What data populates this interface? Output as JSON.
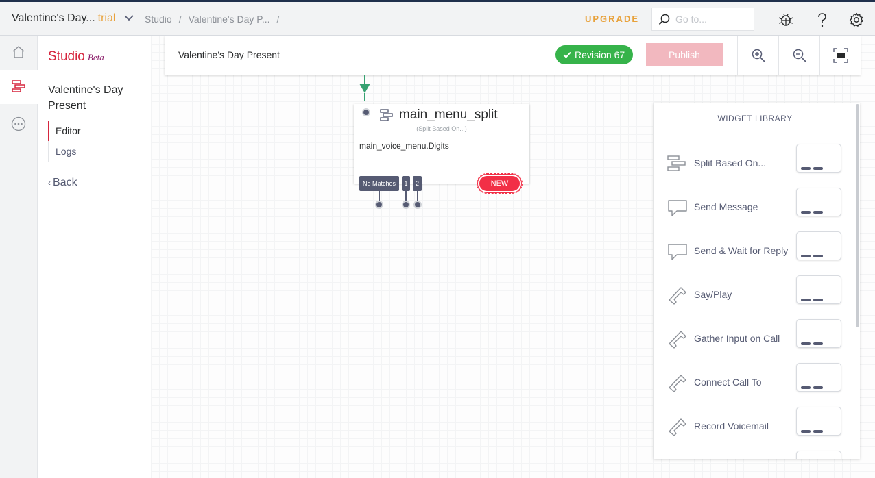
{
  "topbar": {
    "project_name": "Valentine's Day...",
    "project_badge": "trial",
    "breadcrumbs": [
      "Studio",
      "Valentine's Day P..."
    ],
    "breadcrumb_sep": "/",
    "upgrade_label": "UPGRADE",
    "search_placeholder": "Go to...",
    "icons": [
      "bug-icon",
      "help-icon",
      "settings-icon"
    ]
  },
  "leftnav": {
    "items": [
      "home-icon",
      "studio-flow-icon",
      "more-icon"
    ],
    "active_index": 1
  },
  "sidebar": {
    "product_name": "Studio",
    "product_tag": "Beta",
    "flow_name": "Valentine's Day Present",
    "nav": [
      {
        "label": "Editor",
        "active": true
      },
      {
        "label": "Logs",
        "active": false
      }
    ],
    "back_label": "Back"
  },
  "canvas_header": {
    "title": "Valentine's Day Present",
    "revision_label": "Revision 67",
    "publish_label": "Publish",
    "tools": [
      "zoom-in-icon",
      "zoom-out-icon",
      "fit-to-screen-icon"
    ]
  },
  "node": {
    "name": "main_menu_split",
    "type": "(Split Based On...)",
    "expression": "main_voice_menu.Digits",
    "transitions": [
      "No Matches",
      "1",
      "2"
    ],
    "new_label": "NEW"
  },
  "library": {
    "title": "WIDGET LIBRARY",
    "items": [
      {
        "label": "Split Based On...",
        "icon": "split-icon"
      },
      {
        "label": "Send Message",
        "icon": "message-icon"
      },
      {
        "label": "Send & Wait for Reply",
        "icon": "message-icon"
      },
      {
        "label": "Say/Play",
        "icon": "phone-icon"
      },
      {
        "label": "Gather Input on Call",
        "icon": "phone-icon"
      },
      {
        "label": "Connect Call To",
        "icon": "phone-icon"
      },
      {
        "label": "Record Voicemail",
        "icon": "phone-icon"
      }
    ]
  },
  "colors": {
    "brand_red": "#f22f46",
    "studio_red": "#d6263e",
    "upgrade_orange": "#e8a13a",
    "revision_green": "#36b34a",
    "navy": "#1f304c"
  }
}
